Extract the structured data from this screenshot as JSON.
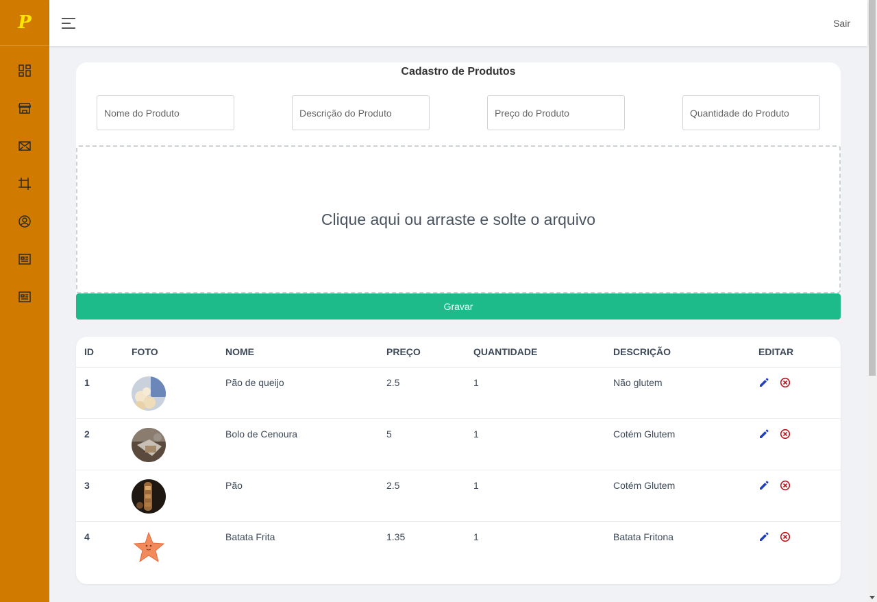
{
  "app": {
    "logo_text": "P",
    "brand_color": "#d07b00",
    "logo_color": "#ffe600"
  },
  "sidebar": {
    "items": [
      {
        "icon": "dashboard-icon",
        "name": "sidebar-item-dashboard"
      },
      {
        "icon": "store-icon",
        "name": "sidebar-item-store"
      },
      {
        "icon": "mail-icon",
        "name": "sidebar-item-messages"
      },
      {
        "icon": "crop-icon",
        "name": "sidebar-item-crop"
      },
      {
        "icon": "user-circle-icon",
        "name": "sidebar-item-profile"
      },
      {
        "icon": "id-card-icon",
        "name": "sidebar-item-card-1"
      },
      {
        "icon": "id-card-icon",
        "name": "sidebar-item-card-2"
      }
    ]
  },
  "topbar": {
    "menu_icon": "hamburger-icon",
    "logout_label": "Sair"
  },
  "form": {
    "title": "Cadastro de Produtos",
    "name_placeholder": "Nome do Produto",
    "description_placeholder": "Descrição do Produto",
    "price_placeholder": "Preço do Produto",
    "quantity_placeholder": "Quantidade do Produto",
    "dropzone_text": "Clique aqui ou arraste e solte o arquivo",
    "save_label": "Gravar",
    "save_color": "#1dba8a"
  },
  "table": {
    "headers": {
      "id": "ID",
      "foto": "FOTO",
      "nome": "NOME",
      "preco": "PREÇO",
      "quantidade": "QUANTIDADE",
      "descricao": "DESCRIÇÃO",
      "editar": "EDITAR"
    },
    "rows": [
      {
        "id": "1",
        "nome": "Pão de queijo",
        "preco": "2.5",
        "quantidade": "1",
        "descricao": "Não glutem"
      },
      {
        "id": "2",
        "nome": "Bolo de Cenoura",
        "preco": "5",
        "quantidade": "1",
        "descricao": "Cotém Glutem"
      },
      {
        "id": "3",
        "nome": "Pão",
        "preco": "2.5",
        "quantidade": "1",
        "descricao": "Cotém Glutem"
      },
      {
        "id": "4",
        "nome": "Batata Frita",
        "preco": "1.35",
        "quantidade": "1",
        "descricao": "Batata Fritona"
      }
    ],
    "edit_icon": "pencil-icon",
    "delete_icon": "circle-x-icon",
    "edit_color": "#1f3fbf",
    "delete_color": "#b8151c"
  }
}
